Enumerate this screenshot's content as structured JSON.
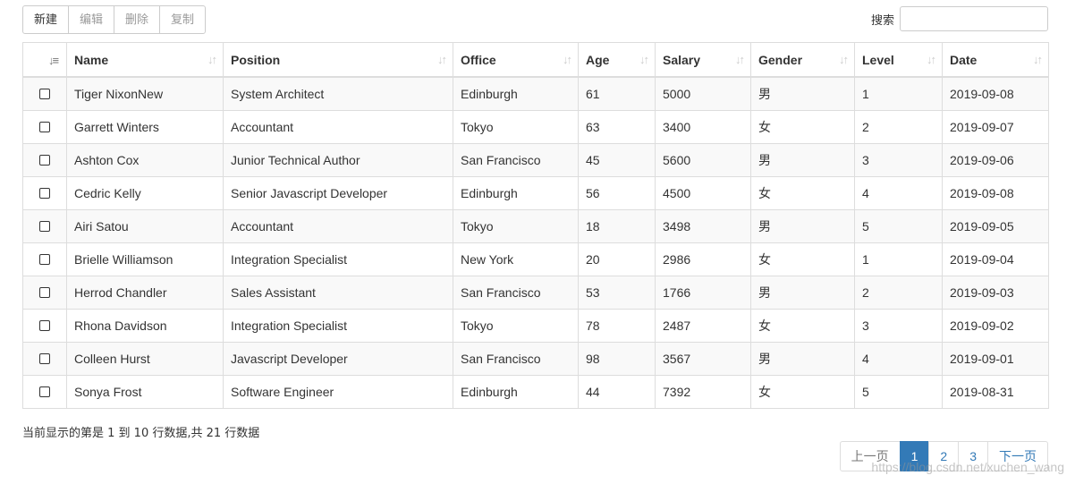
{
  "toolbar": {
    "new": "新建",
    "edit": "编辑",
    "delete": "删除",
    "copy": "复制"
  },
  "search": {
    "label": "搜索",
    "value": ""
  },
  "columns": [
    "Name",
    "Position",
    "Office",
    "Age",
    "Salary",
    "Gender",
    "Level",
    "Date"
  ],
  "rows": [
    [
      "Tiger NixonNew",
      "System Architect",
      "Edinburgh",
      "61",
      "5000",
      "男",
      "1",
      "2019-09-08"
    ],
    [
      "Garrett Winters",
      "Accountant",
      "Tokyo",
      "63",
      "3400",
      "女",
      "2",
      "2019-09-07"
    ],
    [
      "Ashton Cox",
      "Junior Technical Author",
      "San Francisco",
      "45",
      "5600",
      "男",
      "3",
      "2019-09-06"
    ],
    [
      "Cedric Kelly",
      "Senior Javascript Developer",
      "Edinburgh",
      "56",
      "4500",
      "女",
      "4",
      "2019-09-08"
    ],
    [
      "Airi Satou",
      "Accountant",
      "Tokyo",
      "18",
      "3498",
      "男",
      "5",
      "2019-09-05"
    ],
    [
      "Brielle Williamson",
      "Integration Specialist",
      "New York",
      "20",
      "2986",
      "女",
      "1",
      "2019-09-04"
    ],
    [
      "Herrod Chandler",
      "Sales Assistant",
      "San Francisco",
      "53",
      "1766",
      "男",
      "2",
      "2019-09-03"
    ],
    [
      "Rhona Davidson",
      "Integration Specialist",
      "Tokyo",
      "78",
      "2487",
      "女",
      "3",
      "2019-09-02"
    ],
    [
      "Colleen Hurst",
      "Javascript Developer",
      "San Francisco",
      "98",
      "3567",
      "男",
      "4",
      "2019-09-01"
    ],
    [
      "Sonya Frost",
      "Software Engineer",
      "Edinburgh",
      "44",
      "7392",
      "女",
      "5",
      "2019-08-31"
    ]
  ],
  "info": "当前显示的第是 1 到 10 行数据,共 21 行数据",
  "pagination": {
    "prev": "上一页",
    "pages": [
      "1",
      "2",
      "3"
    ],
    "active": "1",
    "next": "下一页"
  },
  "watermark": "https://blog.csdn.net/xuchen_wang"
}
